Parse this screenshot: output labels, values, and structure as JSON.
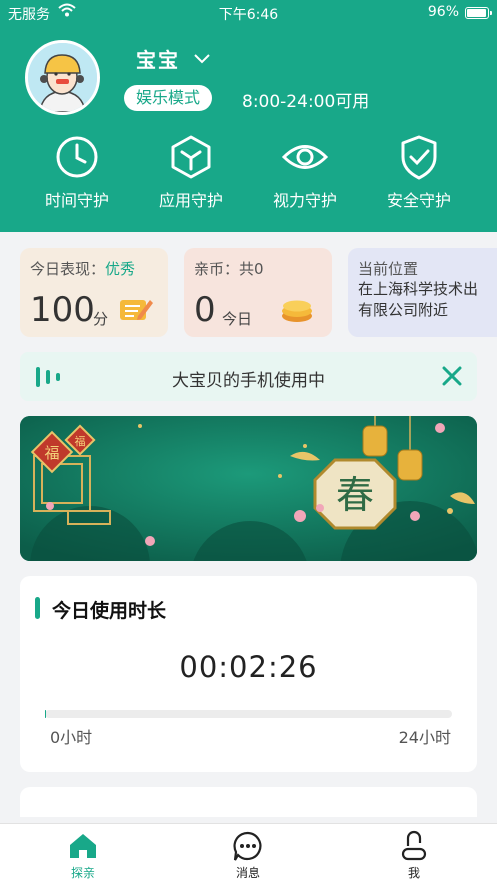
{
  "status_bar": {
    "carrier": "无服务",
    "time": "下午6:46",
    "battery": "96%"
  },
  "profile": {
    "name": "宝宝",
    "mode": "娱乐模式",
    "available_time": "8:00-24:00可用"
  },
  "guards": [
    {
      "label": "时间守护",
      "icon": "clock-icon"
    },
    {
      "label": "应用守护",
      "icon": "app-box-icon"
    },
    {
      "label": "视力守护",
      "icon": "eye-icon"
    },
    {
      "label": "安全守护",
      "icon": "shield-check-icon"
    }
  ],
  "cards": {
    "performance": {
      "title": "今日表现：",
      "rating": "优秀",
      "score": "100",
      "unit": "分"
    },
    "coins": {
      "title": "亲币：共0",
      "value": "0",
      "unit": "今日"
    },
    "location": {
      "title": "当前位置",
      "line1": "在上海科学技术出",
      "line2": "有限公司附近"
    }
  },
  "notice": {
    "text": "大宝贝的手机使用中"
  },
  "banner": {
    "char": "春",
    "fu": "福"
  },
  "usage": {
    "title": "今日使用时长",
    "duration": "00:02:26",
    "min_label": "0小时",
    "max_label": "24小时",
    "progress_fraction": 0.0017
  },
  "tabs": [
    {
      "label": "探亲",
      "icon": "home-icon",
      "active": true
    },
    {
      "label": "消息",
      "icon": "message-icon",
      "active": false
    },
    {
      "label": "我",
      "icon": "profile-icon",
      "active": false
    }
  ],
  "colors": {
    "brand": "#18a889",
    "background": "#f2f3f5"
  }
}
